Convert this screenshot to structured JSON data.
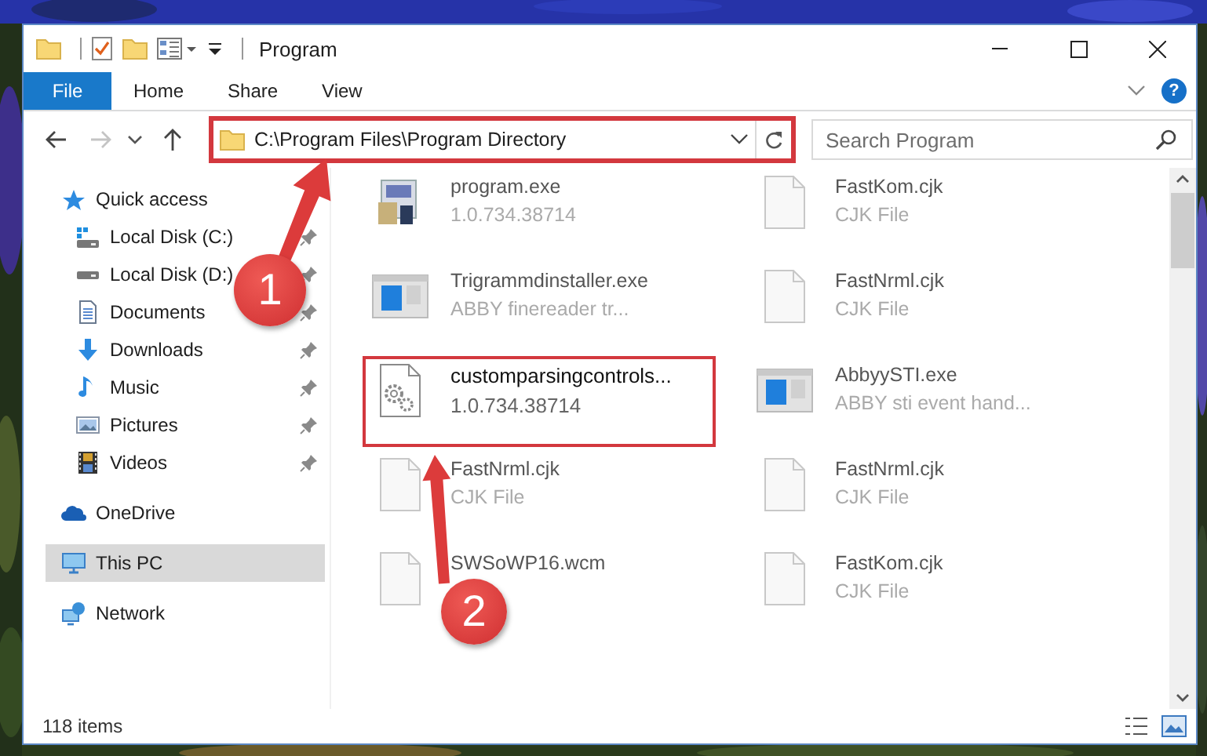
{
  "window": {
    "title": "Program"
  },
  "ribbon": {
    "file_tab": "File",
    "tabs": [
      "Home",
      "Share",
      "View"
    ],
    "help": "?"
  },
  "navigation": {
    "back_enabled": true,
    "forward_enabled": false
  },
  "address": {
    "path": "C:\\Program Files\\Program Directory",
    "highlighted": true
  },
  "search": {
    "placeholder": "Search Program"
  },
  "sidebar": {
    "items": [
      {
        "label": "Quick access",
        "kind": "star",
        "selected": false,
        "children": [
          {
            "label": "Local Disk (C:)",
            "kind": "system-drive",
            "pinned": true,
            "selected": false
          },
          {
            "label": "Local Disk (D:)",
            "kind": "drive",
            "pinned": true,
            "selected": false
          },
          {
            "label": "Documents",
            "kind": "documents",
            "pinned": true,
            "selected": false
          },
          {
            "label": "Downloads",
            "kind": "downloads",
            "pinned": true,
            "selected": false
          },
          {
            "label": "Music",
            "kind": "music",
            "pinned": true,
            "selected": false
          },
          {
            "label": "Pictures",
            "kind": "pictures",
            "pinned": true,
            "selected": false
          },
          {
            "label": "Videos",
            "kind": "videos",
            "pinned": true,
            "selected": false
          }
        ]
      },
      {
        "label": "OneDrive",
        "kind": "cloud",
        "selected": false
      },
      {
        "label": "This PC",
        "kind": "computer",
        "selected": true
      },
      {
        "label": "Network",
        "kind": "network",
        "selected": false
      }
    ]
  },
  "files": [
    {
      "name": "program.exe",
      "detail": "1.0.734.38714",
      "kind": "installer",
      "highlighted": false
    },
    {
      "name": "FastKom.cjk",
      "detail": "CJK File",
      "kind": "document",
      "highlighted": false
    },
    {
      "name": "Trigrammdinstaller.exe",
      "detail": "ABBY finereader tr...",
      "kind": "application",
      "highlighted": false
    },
    {
      "name": "FastNrml.cjk",
      "detail": "CJK File",
      "kind": "document",
      "highlighted": false
    },
    {
      "name": "customparsingcontrols...",
      "detail": "1.0.734.38714",
      "kind": "settings-file",
      "highlighted": true
    },
    {
      "name": "AbbyySTI.exe",
      "detail": "ABBY sti event hand...",
      "kind": "application",
      "highlighted": false
    },
    {
      "name": "FastNrml.cjk",
      "detail": "CJK File",
      "kind": "document",
      "highlighted": false
    },
    {
      "name": "FastNrml.cjk",
      "detail": "CJK File",
      "kind": "document",
      "highlighted": false
    },
    {
      "name": "SWSoWP16.wcm",
      "kind": "document",
      "highlighted": false
    },
    {
      "name": "FastKom.cjk",
      "detail": "CJK File",
      "kind": "document",
      "highlighted": false
    }
  ],
  "status_bar": {
    "item_count": "118 items"
  },
  "annotations": [
    {
      "number": "1"
    },
    {
      "number": "2"
    }
  ]
}
